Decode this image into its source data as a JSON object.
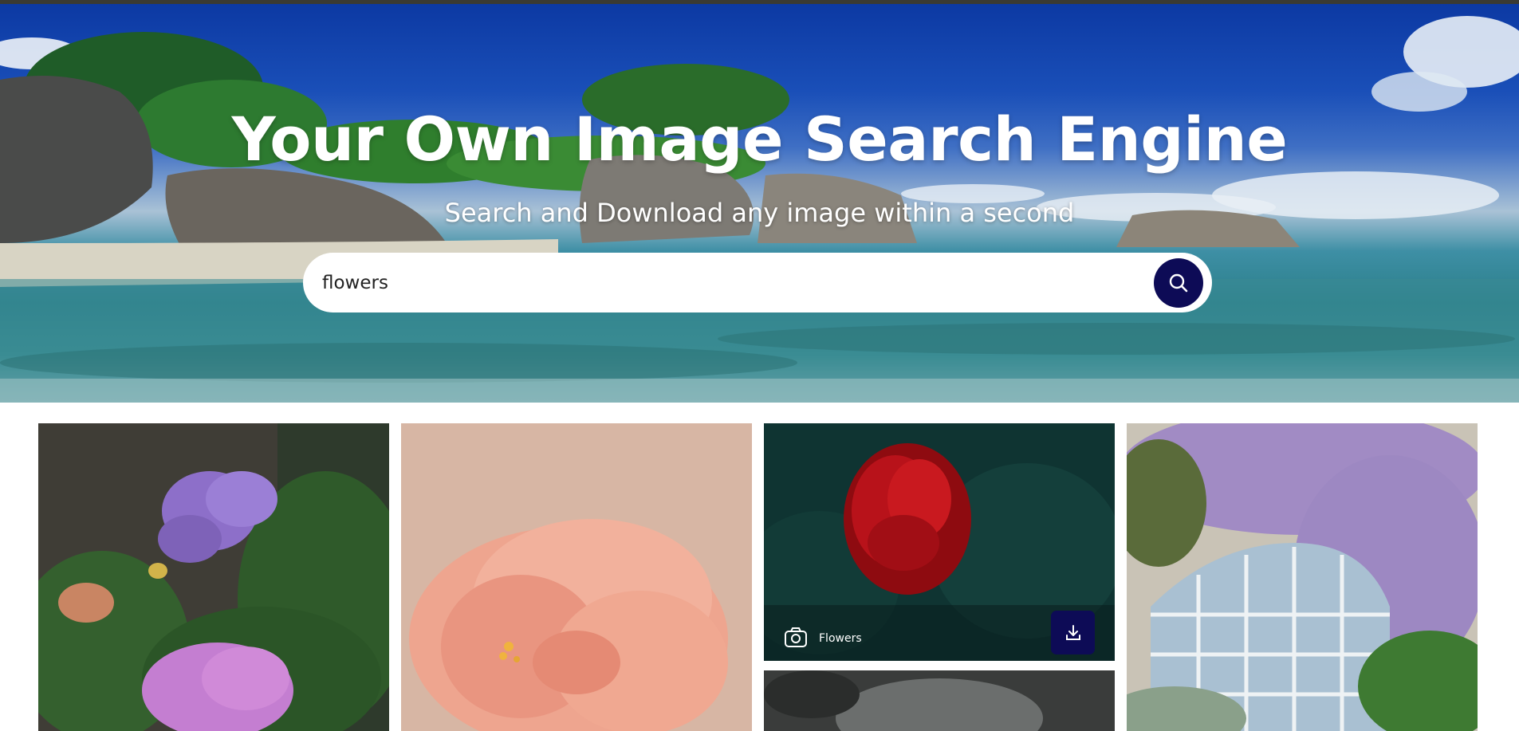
{
  "hero": {
    "title": "Your Own Image Search Engine",
    "subtitle": "Search and Download any image within a second"
  },
  "search": {
    "value": "flowers",
    "button_icon": "search-icon"
  },
  "colors": {
    "accent": "#0d0b56",
    "hero_sky": "#0c39a3"
  },
  "results": [
    {
      "subject": "hydrangea",
      "photographer": ""
    },
    {
      "subject": "peony",
      "photographer": ""
    },
    {
      "subject": "red-rose",
      "photographer": "Flowers",
      "download_icon": "download-icon",
      "camera_icon": "camera-icon"
    },
    {
      "subject": "wisteria",
      "photographer": ""
    },
    {
      "subject": "dark-bokeh",
      "photographer": ""
    }
  ]
}
